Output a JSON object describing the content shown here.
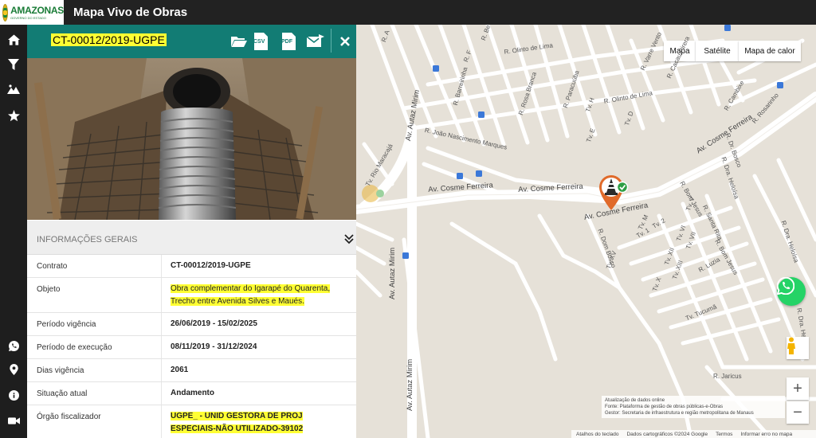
{
  "app": {
    "logo_name": "AMAZONAS",
    "logo_subtitle": "GOVERNO DO ESTADO",
    "title": "Mapa Vivo de Obras"
  },
  "nav": {
    "items": [
      {
        "icon": "home-icon"
      },
      {
        "icon": "filter-icon"
      },
      {
        "icon": "landscape-icon"
      },
      {
        "icon": "star-icon"
      },
      {
        "icon": "whatsapp-icon"
      },
      {
        "icon": "location-pin-icon"
      },
      {
        "icon": "info-icon"
      },
      {
        "icon": "video-camera-icon"
      }
    ]
  },
  "panel": {
    "contract_code": "CT-00012/2019-UGPE",
    "header_icons": [
      "folder-open-icon",
      "csv-file-icon",
      "pdf-file-icon",
      "email-icon",
      "close-icon"
    ],
    "csv_label": "CSV",
    "pdf_label": "PDF",
    "section_title": "INFORMAÇÕES GERAIS",
    "rows": [
      {
        "label": "Contrato",
        "value": "CT-00012/2019-UGPE"
      },
      {
        "label": "Objeto",
        "value_line1": "Obra complementar do Igarapé do Quarenta,",
        "value_line2": "Trecho entre Avenida Silves e Maués."
      },
      {
        "label": "Período vigência",
        "value": "26/06/2019 - 15/02/2025"
      },
      {
        "label": "Período de execução",
        "value": "08/11/2019 - 31/12/2024"
      },
      {
        "label": "Dias vigência",
        "value": "2061"
      },
      {
        "label": "Situação atual",
        "value": "Andamento"
      },
      {
        "label": "Órgão fiscalizador",
        "value_line1": "UGPE_ - UNID GESTORA DE PROJ",
        "value_line2": "ESPECIAIS-NÃO UTILIZADO-39102"
      }
    ]
  },
  "map": {
    "type_buttons": [
      "Mapa",
      "Satélite",
      "Mapa de calor"
    ],
    "streets": {
      "cosme1": "Av. Cosme Ferreira",
      "cosme2": "Av. Cosme Ferreira",
      "cosme3": "Av. Cosme Ferreira",
      "cosme4": "Av. Cosme Ferreira",
      "autaz1": "Av. Autaz Mirim",
      "autaz2": "Av. Autaz Mirim",
      "autaz3": "Av. Autaz Mirim",
      "olinto1": "R. Olinto de Lima",
      "olinto2": "R. Olinto de Lima",
      "joao": "R. João Nascimento Marques",
      "barreirinha": "R. Barreirinha",
      "rosa": "R. Rosa Branca",
      "paracuuba": "R. Paracuúba",
      "cacau": "R. Cacau Pirera",
      "varre": "R. Varre Vento",
      "cambixe": "R. Cambixe",
      "rosarinho": "R. Rosarinho",
      "bosco": "R. Dr. Bosco",
      "heloisa": "R. Dra. Heloísa",
      "heloisa2": "R. Dra. Heloísa",
      "heloisa3": "R. Dra. Helo",
      "santarita": "R. Santa Rita",
      "bomjesus": "R. Bom Jesus",
      "bomjesus2": "R. Bom Jesus",
      "luzia": "R. Luzia",
      "tucuma": "Tv. Tucumã",
      "jaricus": "R. Jaricus",
      "dombosco": "R. Dom Bosco",
      "rio": "Tv. Rio Maracajá",
      "tv1": "Tv. 1",
      "tv2": "Tv. 2",
      "tv5": "Tv. V",
      "tv6": "Tv. VI",
      "tv7": "Tv. VII",
      "tv12": "Tv. XII",
      "tv13": "Tv. XIII",
      "tv15": "Tv. XV",
      "tvx": "Tv. X",
      "tvh": "Tv. H",
      "tve": "Tv. E",
      "tvd": "Tv. D",
      "tvm": "Tv. M",
      "ruaa": "R. A",
      "ruab": "Rua B",
      "ruaf": "R. F",
      "ruabe": "R. Be"
    },
    "attribution": {
      "line1": "Atualização de dados online",
      "line2": "Fonte: Plataforma de gestão de obras públicas-e-Obras",
      "line3": "Gestor: Secretaria de infraestrutura e região metropolitana de Manaus"
    },
    "footer": [
      "Atalhos do teclado",
      "Dados cartográficos ©2024 Google",
      "Termos",
      "Informar erro no mapa"
    ],
    "zoom_in": "+",
    "zoom_out": "−",
    "marker_status": "concluded-check"
  }
}
